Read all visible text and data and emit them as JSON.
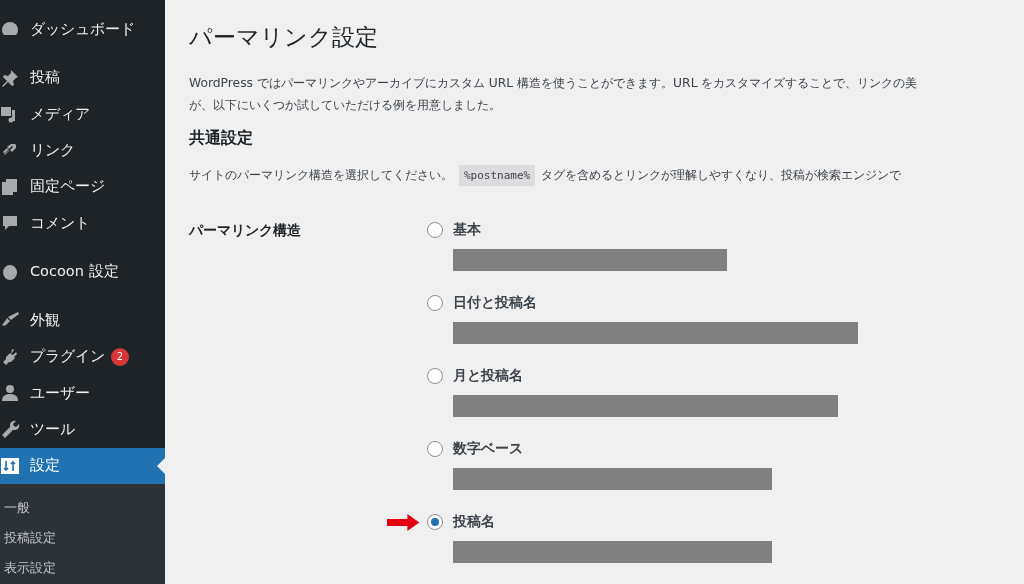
{
  "sidebar": {
    "groups": [
      [
        {
          "label": "ダッシュボード",
          "selected": false
        }
      ],
      [
        {
          "label": "投稿",
          "selected": false
        },
        {
          "label": "メディア",
          "selected": false
        },
        {
          "label": "リンク",
          "selected": false
        },
        {
          "label": "固定ページ",
          "selected": false
        },
        {
          "label": "コメント",
          "selected": false
        }
      ],
      [
        {
          "label": "Cocoon 設定",
          "selected": false
        }
      ],
      [
        {
          "label": "外観",
          "selected": false
        },
        {
          "label": "プラグイン",
          "selected": false,
          "badge": "2"
        },
        {
          "label": "ユーザー",
          "selected": false
        },
        {
          "label": "ツール",
          "selected": false
        },
        {
          "label": "設定",
          "selected": true
        }
      ]
    ],
    "submenu": [
      "一般",
      "投稿設定",
      "表示設定"
    ]
  },
  "page": {
    "title": "パーマリンク設定",
    "intro": [
      "WordPress ではパーマリンクやアーカイブにカスタム URL 構造を使うことができます。URL をカスタマイズすることで、リンクの美",
      "が、以下にいくつか試していただける例を用意しました。"
    ],
    "section": "共通設定",
    "hint_before": "サイトのパーマリンク構造を選択してください。",
    "hint_code": "%postname%",
    "hint_after": "タグを含めるとリンクが理解しやすくなり、投稿が検索エンジンで",
    "field_label": "パーマリンク構造",
    "options": [
      {
        "label": "基本",
        "selected": false,
        "pointer": false
      },
      {
        "label": "日付と投稿名",
        "selected": false,
        "pointer": false
      },
      {
        "label": "月と投稿名",
        "selected": false,
        "pointer": false
      },
      {
        "label": "数字ベース",
        "selected": false,
        "pointer": false
      },
      {
        "label": "投稿名",
        "selected": true,
        "pointer": true
      }
    ]
  }
}
